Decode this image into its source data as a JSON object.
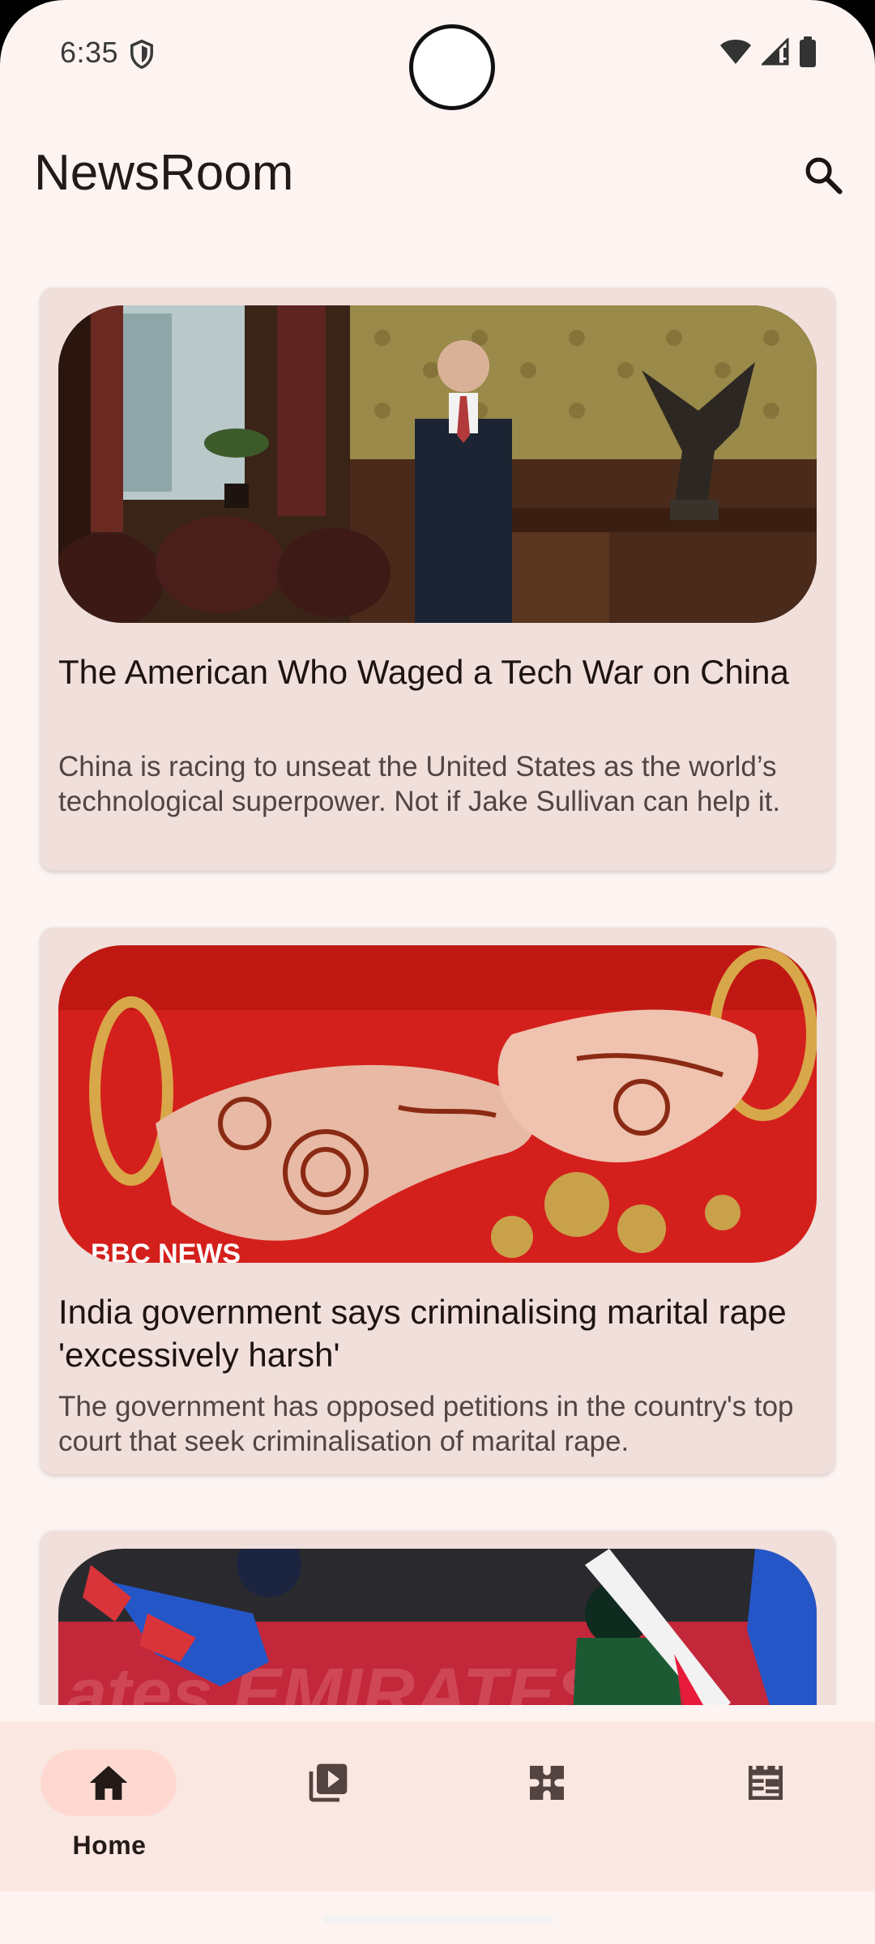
{
  "status_bar": {
    "time": "6:35",
    "icons": [
      "shield-icon",
      "wifi-icon",
      "cellular-signal-icon",
      "battery-icon"
    ]
  },
  "app_bar": {
    "title": "NewsRoom",
    "search_icon": "search-icon"
  },
  "articles": [
    {
      "title": "The American Who Waged a Tech War on China",
      "description": "China is racing to unseat the United States as the world’s technological superpower. Not if Jake Sullivan can help it.",
      "image": "man in suit standing in ornate office with eagle statue"
    },
    {
      "title": "India government says criminalising marital rape 'excessively harsh'",
      "description": "The government has opposed petitions in the country's top court that seek criminalisation of marital rape.",
      "image": "bride hands with henna and red bangles",
      "image_watermark": "BBC NEWS"
    },
    {
      "title": "",
      "description": "",
      "image": "cricket match wicketkeeper diving and batter"
    }
  ],
  "bottom_nav": {
    "items": [
      {
        "label": "Home",
        "icon": "home-icon",
        "selected": true
      },
      {
        "label": "",
        "icon": "video-library-icon",
        "selected": false
      },
      {
        "label": "",
        "icon": "puzzle-icon",
        "selected": false
      },
      {
        "label": "",
        "icon": "newspaper-icon",
        "selected": false
      }
    ]
  },
  "colors": {
    "background": "#fdf4f2",
    "card": "#f0dfda",
    "nav_background": "#fbe7e1",
    "nav_pill": "#ffd9d1",
    "text_primary": "#1d1311",
    "text_secondary": "#534341"
  }
}
